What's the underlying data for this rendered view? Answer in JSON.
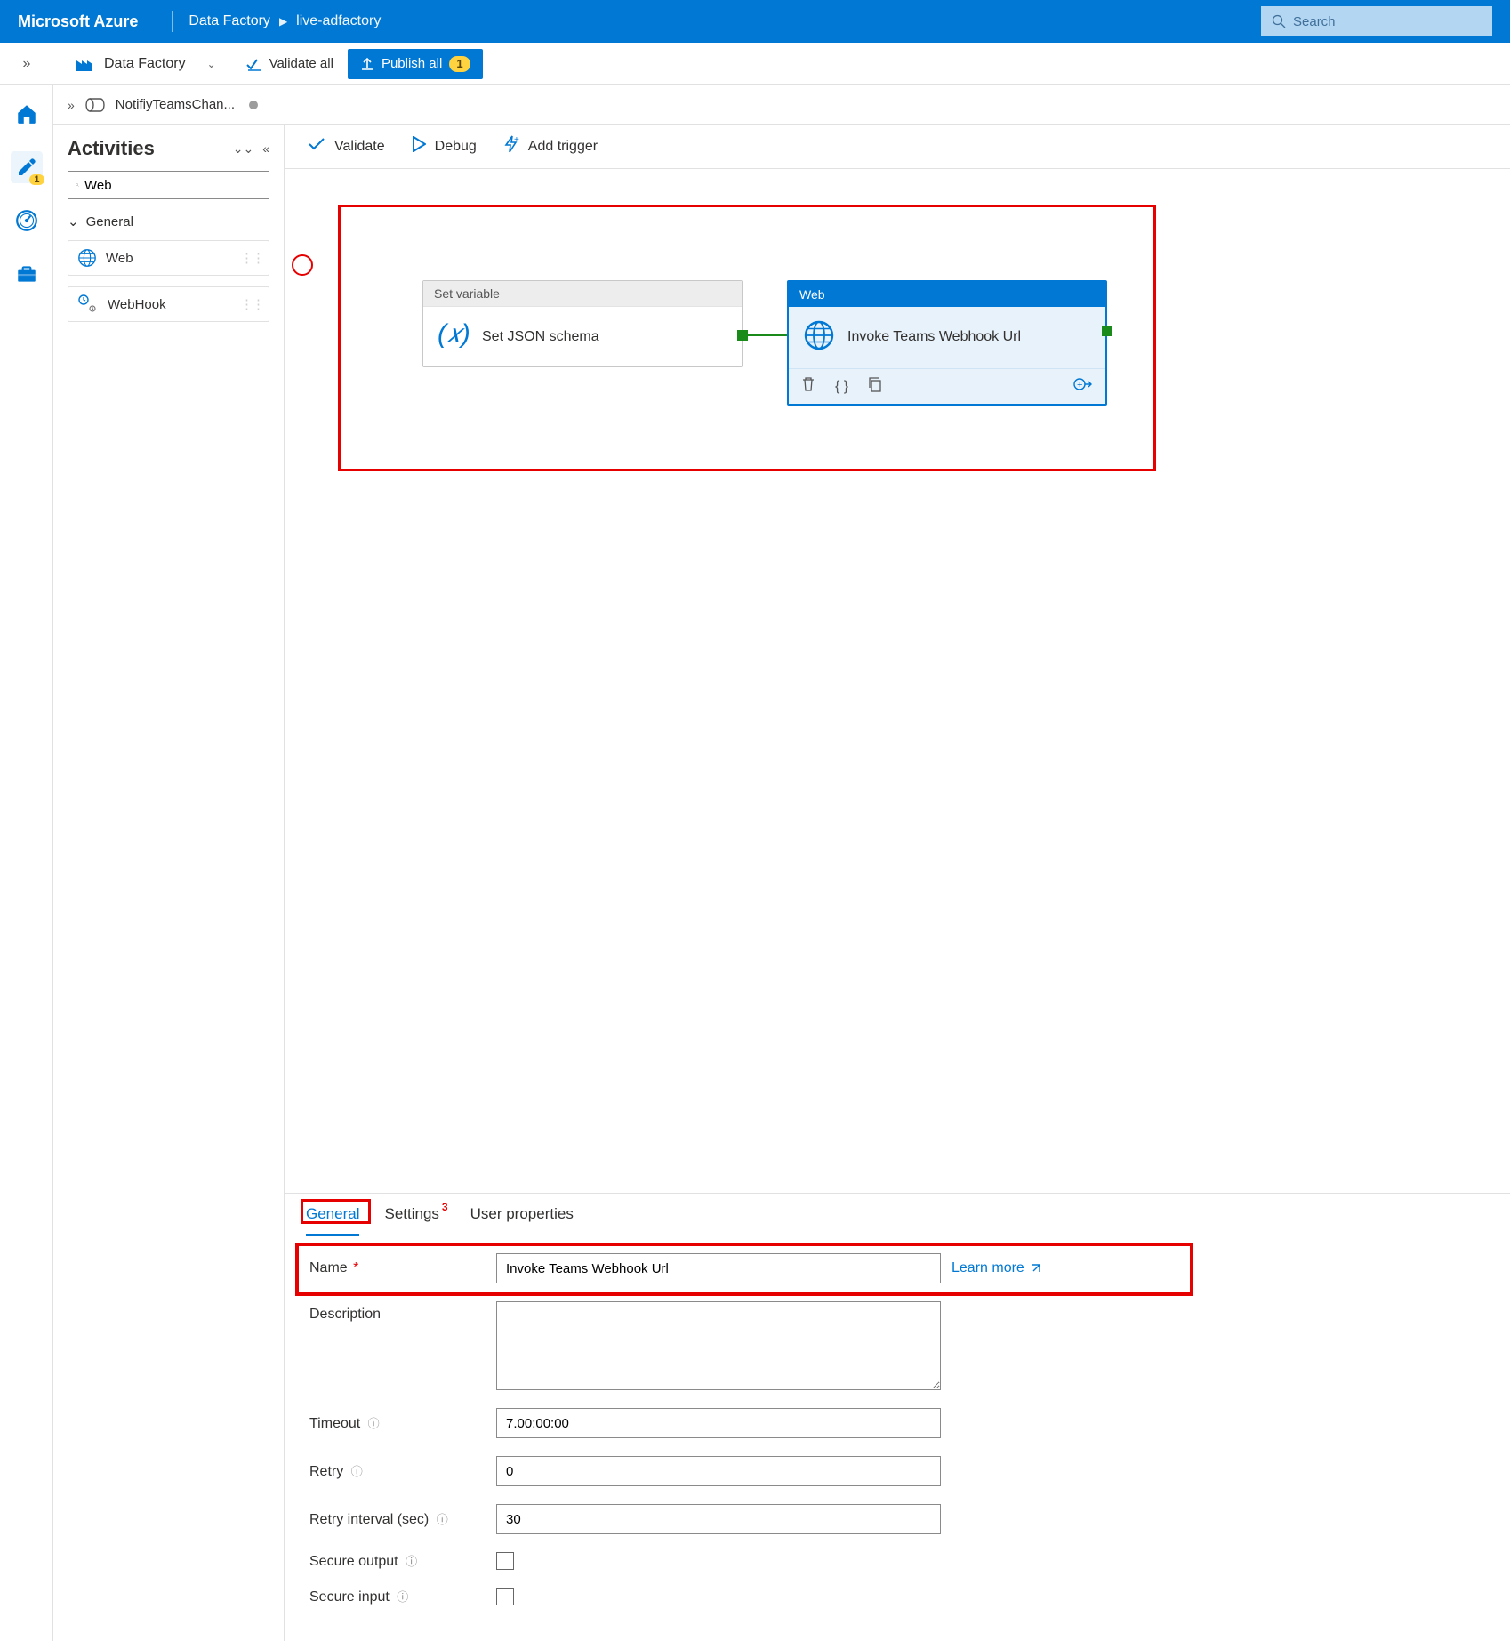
{
  "header": {
    "brand": "Microsoft Azure",
    "crumb1": "Data Factory",
    "crumb2": "live-adfactory",
    "search_placeholder": "Search"
  },
  "cmdbar": {
    "df_label": "Data Factory",
    "validate_all": "Validate all",
    "publish_all": "Publish all",
    "publish_badge": "1"
  },
  "rail": {
    "pencil_badge": "1"
  },
  "tab": {
    "title": "NotifiyTeamsChan..."
  },
  "activities": {
    "title": "Activities",
    "search_value": "Web",
    "group": "General",
    "items": [
      {
        "label": "Web"
      },
      {
        "label": "WebHook"
      }
    ]
  },
  "canvas_toolbar": {
    "validate": "Validate",
    "debug": "Debug",
    "add_trigger": "Add trigger"
  },
  "nodes": {
    "n1": {
      "type": "Set variable",
      "title": "Set JSON schema"
    },
    "n2": {
      "type": "Web",
      "title": "Invoke Teams Webhook Url"
    }
  },
  "prop_tabs": {
    "general": "General",
    "settings": "Settings",
    "settings_badge": "3",
    "user_props": "User properties"
  },
  "form": {
    "name_label": "Name",
    "name_value": "Invoke Teams Webhook Url",
    "learn_more": "Learn more",
    "description_label": "Description",
    "description_value": "",
    "timeout_label": "Timeout",
    "timeout_value": "7.00:00:00",
    "retry_label": "Retry",
    "retry_value": "0",
    "retry_interval_label": "Retry interval (sec)",
    "retry_interval_value": "30",
    "secure_output_label": "Secure output",
    "secure_input_label": "Secure input"
  }
}
